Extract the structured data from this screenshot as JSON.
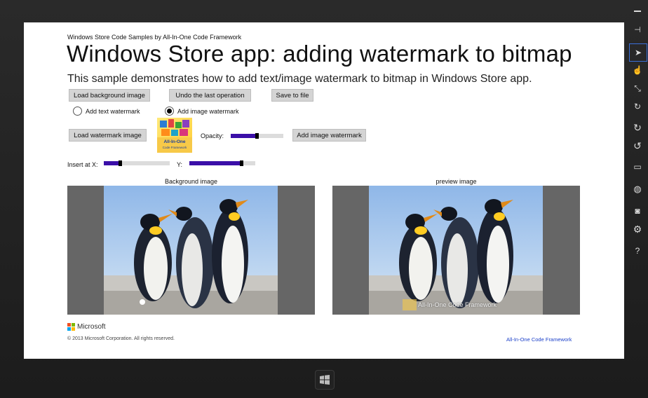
{
  "header": {
    "subtitle": "Windows Store Code Samples by All-In-One Code Framework",
    "title": "Windows Store app: adding watermark to bitmap",
    "description": "This sample demonstrates how to add text/image watermark to bitmap in Windows Store app."
  },
  "toolbar": {
    "load_background_label": "Load background image",
    "undo_label": "Undo the last operation",
    "save_label": "Save to file"
  },
  "mode": {
    "text_option": "Add text watermark",
    "image_option": "Add image watermark",
    "selected": "Add image watermark"
  },
  "watermark": {
    "load_label": "Load watermark image",
    "thumbnail_text": "All-In-One",
    "thumbnail_subtext": "Code Framework",
    "opacity_label": "Opacity:",
    "opacity_value": 0.5,
    "add_label": "Add image watermark"
  },
  "position": {
    "x_label": "Insert at X:",
    "x_value": 0.25,
    "y_label": "Y:",
    "y_value": 0.8
  },
  "panels": {
    "background_title": "Background image",
    "preview_title": "preview image",
    "preview_watermark_text": "All-In-One Code Framework"
  },
  "footer": {
    "brand": "Microsoft",
    "copyright": "© 2013 Microsoft Corporation. All rights reserved.",
    "link": "All-In-One Code Framework"
  },
  "charms": [
    "minimize-icon",
    "pin-icon",
    "pointer-icon",
    "touch-icon",
    "pinch-icon",
    "rotate-touch-icon",
    "rotate-cw-icon",
    "rotate-ccw-icon",
    "display-icon",
    "globe-icon",
    "camera-icon",
    "gear-icon",
    "help-icon"
  ],
  "colors": {
    "accent": "#3b0fa8",
    "button": "#d4d4d4",
    "link": "#1a3fc9"
  }
}
